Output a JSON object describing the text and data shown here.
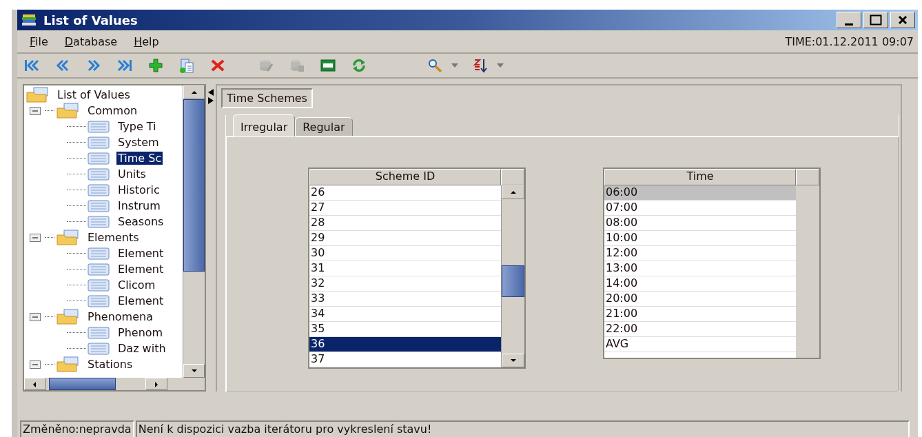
{
  "window": {
    "title": "List of Values"
  },
  "menu": [
    {
      "label": "File"
    },
    {
      "label": "Database"
    },
    {
      "label": "Help"
    }
  ],
  "clock": "TIME:01.12.2011 09:07",
  "toolbar_groups": [
    {
      "buttons": [
        {
          "kind": "first",
          "disabled": false,
          "dropdown": false
        },
        {
          "kind": "prev",
          "disabled": false,
          "dropdown": false
        },
        {
          "kind": "next",
          "disabled": false,
          "dropdown": false
        },
        {
          "kind": "last",
          "disabled": false,
          "dropdown": false
        },
        {
          "kind": "add",
          "disabled": false,
          "dropdown": false
        },
        {
          "kind": "copy",
          "disabled": false,
          "dropdown": false
        },
        {
          "kind": "delete",
          "disabled": false,
          "dropdown": false
        }
      ]
    },
    {
      "buttons": [
        {
          "kind": "edit",
          "disabled": true,
          "dropdown": false
        },
        {
          "kind": "save",
          "disabled": true,
          "dropdown": false
        },
        {
          "kind": "csv",
          "disabled": false,
          "dropdown": false
        },
        {
          "kind": "refresh",
          "disabled": false,
          "dropdown": false
        }
      ]
    },
    {
      "buttons": [
        {
          "kind": "search",
          "disabled": false,
          "dropdown": true
        },
        {
          "kind": "sort",
          "disabled": false,
          "dropdown": true
        }
      ]
    }
  ],
  "tree": {
    "label": "List of Values",
    "children": [
      {
        "label": "Common",
        "expanded": true,
        "children": [
          {
            "label": "Type Ti",
            "selected": false
          },
          {
            "label": "System",
            "selected": false
          },
          {
            "label": "Time Sc",
            "selected": true
          },
          {
            "label": "Units",
            "selected": false
          },
          {
            "label": "Historic",
            "selected": false
          },
          {
            "label": "Instrum",
            "selected": false
          },
          {
            "label": "Seasons",
            "selected": false
          }
        ]
      },
      {
        "label": "Elements",
        "expanded": true,
        "children": [
          {
            "label": "Element",
            "selected": false
          },
          {
            "label": "Element",
            "selected": false
          },
          {
            "label": "Clicom",
            "selected": false
          },
          {
            "label": "Element",
            "selected": false
          }
        ]
      },
      {
        "label": "Phenomena",
        "expanded": true,
        "children": [
          {
            "label": "Phenom",
            "selected": false
          },
          {
            "label": "Daz with",
            "selected": false
          }
        ]
      },
      {
        "label": "Stations",
        "expanded": true
      }
    ]
  },
  "panel": {
    "title": "Time Schemes",
    "tabs": [
      {
        "label": "Irregular",
        "selected": true
      },
      {
        "label": "Regular",
        "selected": false
      }
    ],
    "scheme_table": {
      "column": "Scheme ID",
      "rows": [
        {
          "value": "26",
          "selected": false
        },
        {
          "value": "27",
          "selected": false
        },
        {
          "value": "28",
          "selected": false
        },
        {
          "value": "29",
          "selected": false
        },
        {
          "value": "30",
          "selected": false
        },
        {
          "value": "31",
          "selected": false
        },
        {
          "value": "32",
          "selected": false
        },
        {
          "value": "33",
          "selected": false
        },
        {
          "value": "34",
          "selected": false
        },
        {
          "value": "35",
          "selected": false
        },
        {
          "value": "36",
          "selected": true
        },
        {
          "value": "37",
          "selected": false
        }
      ]
    },
    "time_table": {
      "column": "Time",
      "rows": [
        {
          "value": "06:00",
          "selected": true
        },
        {
          "value": "07:00",
          "selected": false
        },
        {
          "value": "08:00",
          "selected": false
        },
        {
          "value": "10:00",
          "selected": false
        },
        {
          "value": "12:00",
          "selected": false
        },
        {
          "value": "13:00",
          "selected": false
        },
        {
          "value": "14:00",
          "selected": false
        },
        {
          "value": "20:00",
          "selected": false
        },
        {
          "value": "21:00",
          "selected": false
        },
        {
          "value": "22:00",
          "selected": false
        },
        {
          "value": "AVG",
          "selected": false
        }
      ]
    }
  },
  "status_bar": [
    "Změněno:nepravda",
    "Není k dispozici vazba iterátoru pro vykreslení stavu!"
  ]
}
